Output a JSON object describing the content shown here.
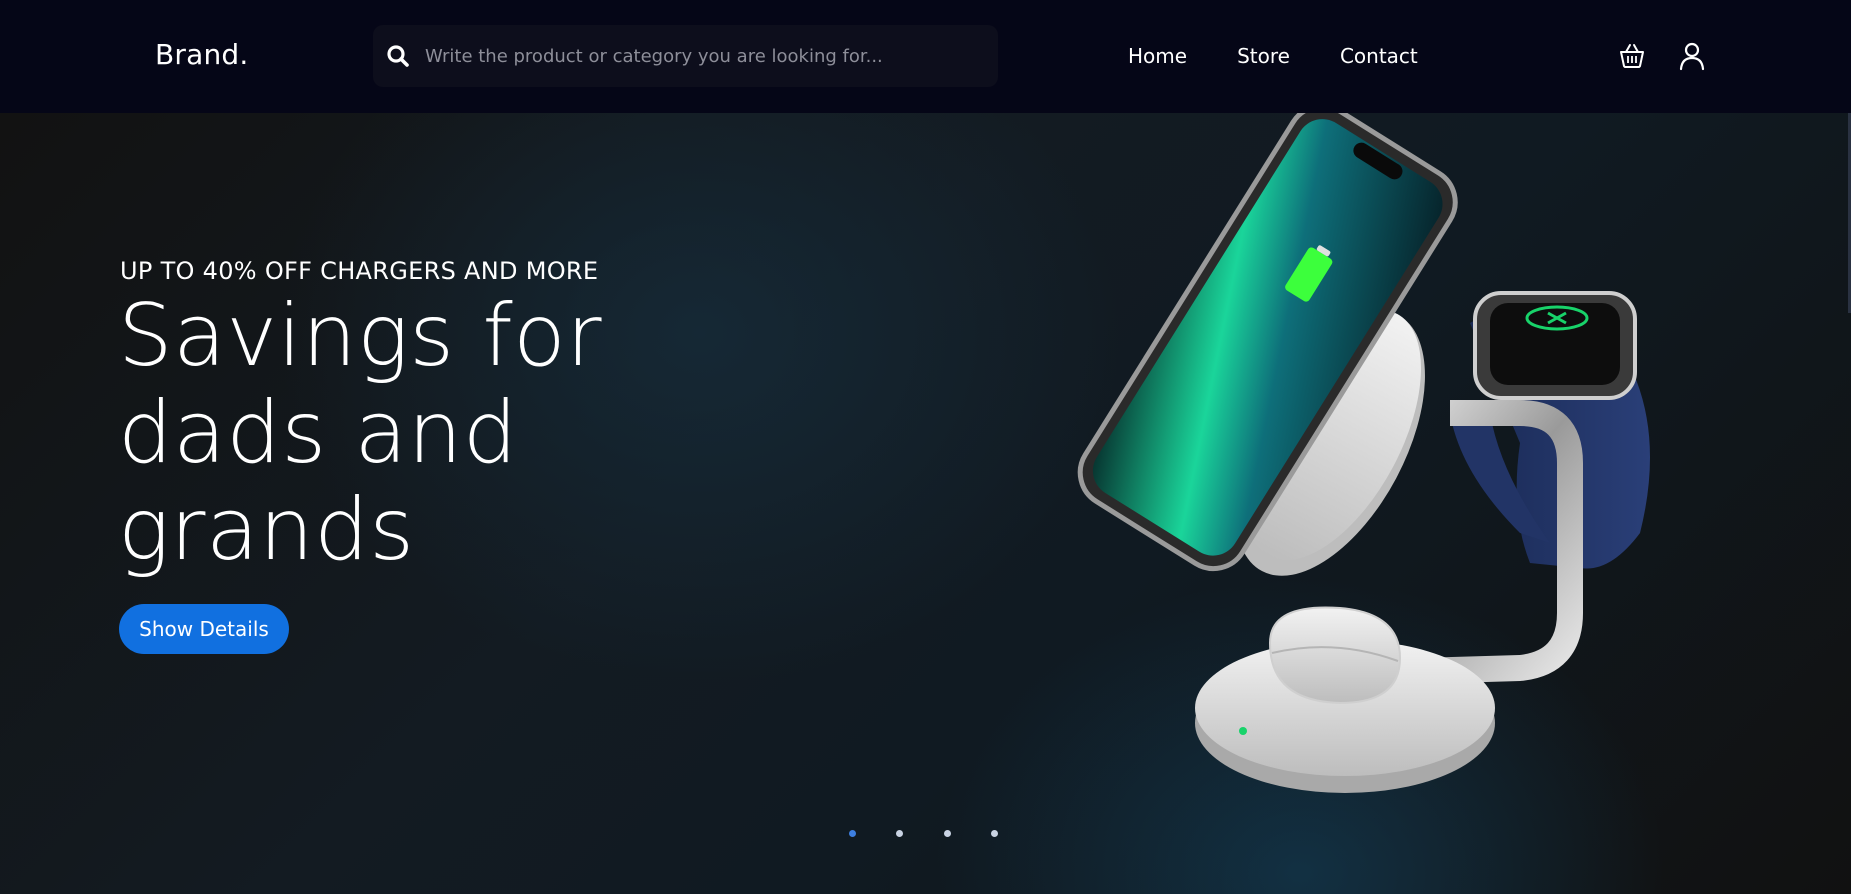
{
  "header": {
    "brand": "Brand.",
    "search": {
      "placeholder": "Write the product or category you are looking for..."
    },
    "nav": [
      {
        "label": "Home"
      },
      {
        "label": "Store"
      },
      {
        "label": "Contact"
      }
    ],
    "icons": {
      "search": "search-icon",
      "cart": "basket-icon",
      "user": "user-icon"
    }
  },
  "hero": {
    "eyebrow": "UP TO 40% OFF CHARGERS AND MORE",
    "headline_lines": [
      "Savings for",
      "dads and",
      "grands"
    ],
    "cta_label": "Show Details",
    "slides": {
      "count": 4,
      "active": 1
    },
    "product_image": "wireless-charging-stand-with-phone-watch-earbuds"
  },
  "colors": {
    "header_bg": "#050617",
    "page_bg": "#111111",
    "accent": "#1170e0",
    "active_dot": "#3d7fe0",
    "dot": "#c9d3e3"
  }
}
